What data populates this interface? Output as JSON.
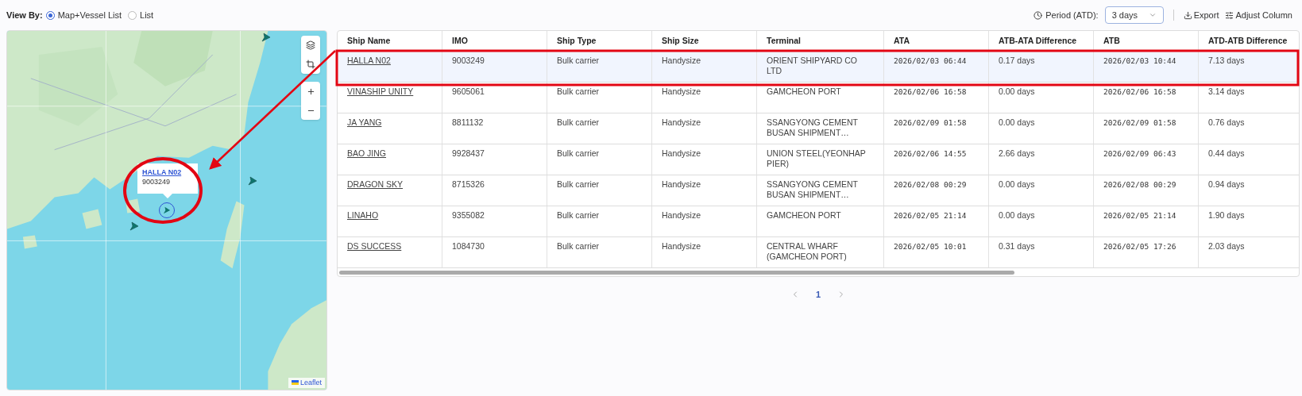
{
  "view_by": {
    "label": "View By:",
    "options": [
      {
        "label": "Map+Vessel List",
        "selected": true
      },
      {
        "label": "List",
        "selected": false
      }
    ]
  },
  "toolbar": {
    "period_label": "Period (ATD):",
    "period_value": "3 days",
    "export": "Export",
    "adjust_column": "Adjust Column"
  },
  "map": {
    "popup": {
      "name": "HALLA N02",
      "imo": "9003249"
    },
    "attribution": "Leaflet"
  },
  "table": {
    "columns": [
      {
        "label": "Ship Name",
        "kind": "link"
      },
      {
        "label": "IMO",
        "kind": "text"
      },
      {
        "label": "Ship Type",
        "kind": "text"
      },
      {
        "label": "Ship Size",
        "kind": "text"
      },
      {
        "label": "Terminal",
        "kind": "text"
      },
      {
        "label": "ATA",
        "kind": "mono"
      },
      {
        "label": "ATB-ATA Difference",
        "kind": "text"
      },
      {
        "label": "ATB",
        "kind": "mono"
      },
      {
        "label": "ATD-ATB Difference",
        "kind": "text"
      }
    ],
    "rows": [
      {
        "selected": true,
        "cells": [
          "HALLA N02",
          "9003249",
          "Bulk carrier",
          "Handysize",
          "ORIENT SHIPYARD CO LTD",
          "2026/02/03 06:44",
          "0.17 days",
          "2026/02/03 10:44",
          "7.13 days"
        ]
      },
      {
        "selected": false,
        "cells": [
          "VINASHIP UNITY",
          "9605061",
          "Bulk carrier",
          "Handysize",
          "GAMCHEON PORT",
          "2026/02/06 16:58",
          "0.00 days",
          "2026/02/06 16:58",
          "3.14 days"
        ]
      },
      {
        "selected": false,
        "cells": [
          "JA YANG",
          "8811132",
          "Bulk carrier",
          "Handysize",
          "SSANGYONG CEMENT BUSAN SHIPMENT…",
          "2026/02/09 01:58",
          "0.00 days",
          "2026/02/09 01:58",
          "0.76 days"
        ]
      },
      {
        "selected": false,
        "cells": [
          "BAO JING",
          "9928437",
          "Bulk carrier",
          "Handysize",
          "UNION STEEL(YEONHAP PIER)",
          "2026/02/06 14:55",
          "2.66 days",
          "2026/02/09 06:43",
          "0.44 days"
        ]
      },
      {
        "selected": false,
        "cells": [
          "DRAGON SKY",
          "8715326",
          "Bulk carrier",
          "Handysize",
          "SSANGYONG CEMENT BUSAN SHIPMENT…",
          "2026/02/08 00:29",
          "0.00 days",
          "2026/02/08 00:29",
          "0.94 days"
        ]
      },
      {
        "selected": false,
        "cells": [
          "LINAHO",
          "9355082",
          "Bulk carrier",
          "Handysize",
          "GAMCHEON PORT",
          "2026/02/05 21:14",
          "0.00 days",
          "2026/02/05 21:14",
          "1.90 days"
        ]
      },
      {
        "selected": false,
        "cells": [
          "DS SUCCESS",
          "1084730",
          "Bulk carrier",
          "Handysize",
          "CENTRAL WHARF (GAMCHEON PORT)",
          "2026/02/05 10:01",
          "0.31 days",
          "2026/02/05 17:26",
          "2.03 days"
        ]
      }
    ]
  },
  "pagination": {
    "pages": [
      {
        "label": "1",
        "selected": true
      }
    ]
  }
}
